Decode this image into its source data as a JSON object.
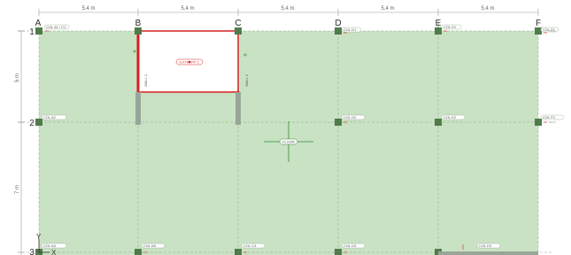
{
  "canvas": {
    "grid_columns": [
      "A",
      "B",
      "C",
      "D",
      "E",
      "F"
    ],
    "grid_rows": [
      "1",
      "2",
      "3"
    ],
    "column_spacings": [
      "5.4 m",
      "5.4 m",
      "5.4 m",
      "5.4 m",
      "5.4 m"
    ],
    "row_spacings": [
      "5 m",
      "7 m"
    ],
    "axis_indicator": {
      "y": "Y",
      "x": "X"
    },
    "selected_panel_label": "EXTRAPP 1",
    "selected_wall_left_label": "WALL 1",
    "selected_wall_right_label": "WALL 2",
    "center_target_label": "FLOOR",
    "column_tags": {
      "A1": "COL A1 / C1",
      "B1": "",
      "C1": "",
      "D1": "COL D1",
      "E1": "COL E1",
      "F1": "COL F1",
      "A2": "COL A2",
      "D2": "COL D2",
      "E2": "COL E2",
      "F2": "COL F2",
      "A3": "COL A3",
      "B3": "COL B3",
      "C3": "COL C3",
      "D3": "COL D3",
      "E3": "COL E3"
    }
  },
  "colors": {
    "slab_fill": "#c9e2c4",
    "grid_line": "#8faa8c",
    "selection": "#d82020",
    "column_node": "#4f7c4a",
    "dim_line": "#9a9a9a"
  }
}
